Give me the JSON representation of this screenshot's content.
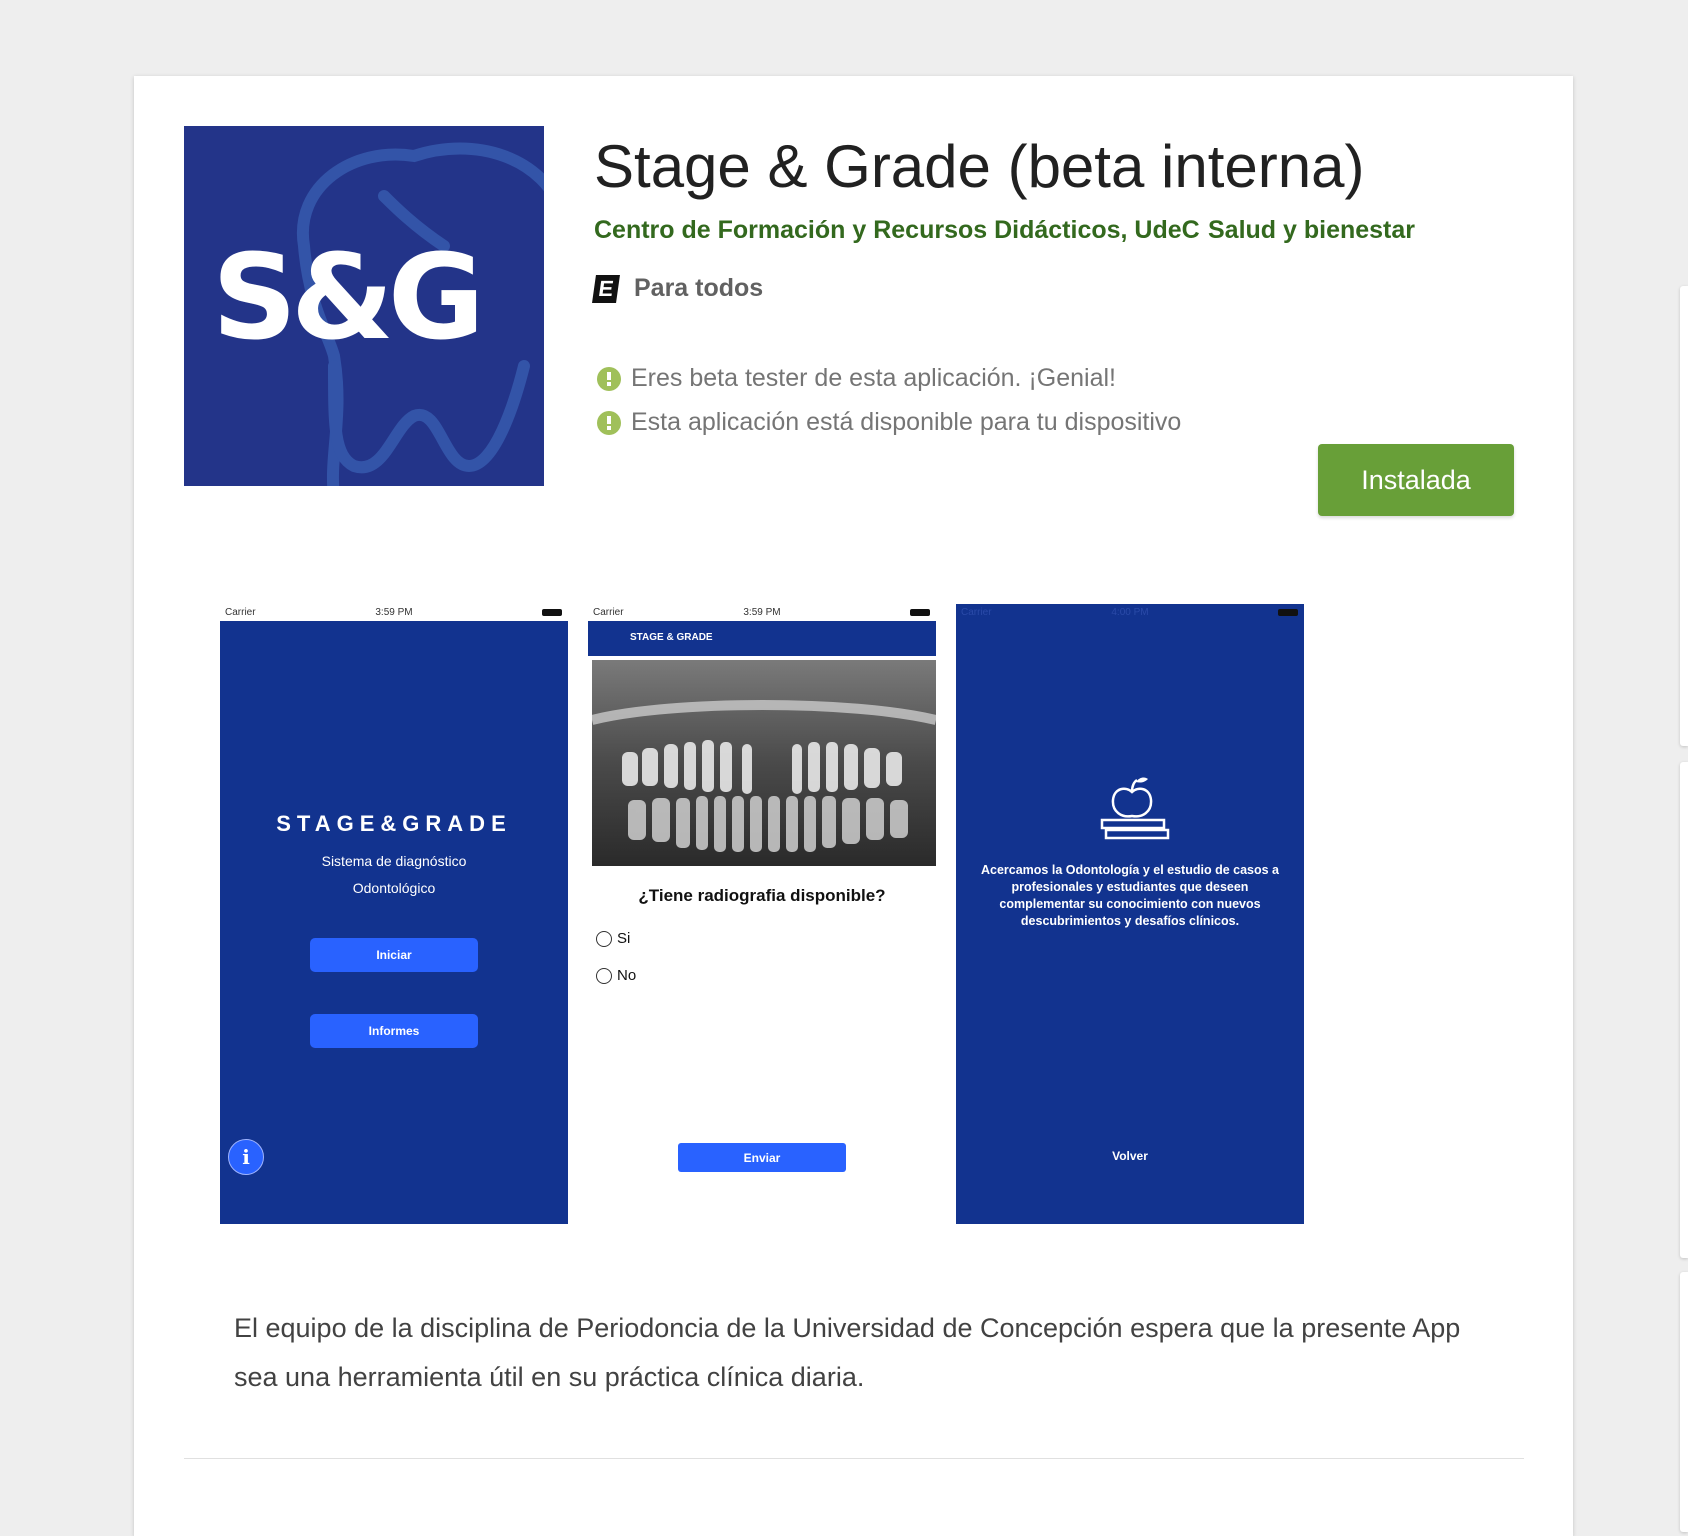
{
  "app": {
    "title": "Stage & Grade (beta interna)",
    "developer": "Centro de Formación y Recursos Didácticos, UdeC",
    "category": "Salud y bienestar",
    "content_rating_badge": "E",
    "content_rating": "Para todos",
    "icon_text": "S&G",
    "notices": [
      "Eres beta tester de esta aplicación. ¡Genial!",
      "Esta aplicación está disponible para tu dispositivo"
    ],
    "install_label": "Instalada"
  },
  "screenshots": [
    {
      "carrier": "Carrier",
      "time": "3:59 PM",
      "logo": "STAGE&GRADE",
      "subtitle_lines": [
        "Sistema de diagnóstico",
        "Odontológico"
      ],
      "buttons": [
        "Iniciar",
        "Informes"
      ],
      "info_label": "i"
    },
    {
      "carrier": "Carrier",
      "time": "3:59 PM",
      "header": "STAGE & GRADE",
      "question": "¿Tiene radiografia disponible?",
      "options": [
        "Si",
        "No"
      ],
      "submit": "Enviar"
    },
    {
      "carrier": "Carrier",
      "time": "4:00 PM",
      "text": "Acercamos la Odontología y el estudio de casos a profesionales y estudiantes que deseen complementar su conocimiento con nuevos descubrimientos y desafíos clínicos.",
      "back": "Volver"
    }
  ],
  "description": "El equipo de la disciplina de Periodoncia de la Universidad de Concepción espera que la presente App sea una herramienta útil en su práctica clínica diaria.",
  "colors": {
    "accent_green": "#689f38",
    "link_green": "#33691e",
    "icon_blue": "#233489",
    "screen_blue": "#12338f",
    "button_blue": "#2962ff"
  }
}
